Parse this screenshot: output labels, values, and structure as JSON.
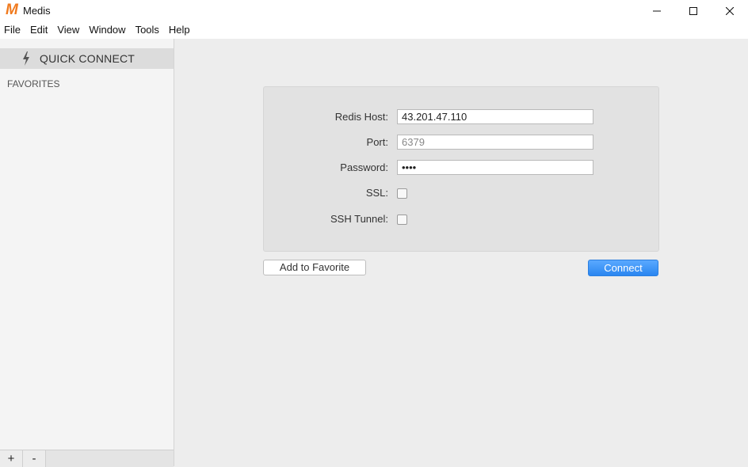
{
  "window": {
    "title": "Medis",
    "logo_letter": "M",
    "controls": [
      "minimize-icon",
      "maximize-icon",
      "close-icon"
    ]
  },
  "menu": [
    "File",
    "Edit",
    "View",
    "Window",
    "Tools",
    "Help"
  ],
  "sidebar": {
    "quick_connect_label": "QUICK CONNECT",
    "quick_connect_icon": "bolt-icon",
    "favorites_title": "FAVORITES",
    "footer": {
      "add_label": "+",
      "remove_label": "-"
    }
  },
  "form": {
    "host_label": "Redis Host:",
    "host_value": "43.201.47.110",
    "port_label": "Port:",
    "port_placeholder": "6379",
    "password_label": "Password:",
    "password_value": "pass",
    "ssl_label": "SSL:",
    "ssl_checked": false,
    "ssh_label": "SSH Tunnel:",
    "ssh_checked": false
  },
  "actions": {
    "favorite_label": "Add to Favorite",
    "connect_label": "Connect"
  },
  "colors": {
    "logo": "#f07a1e",
    "connect_button": "#2a86f0",
    "panel": "#e2e2e2"
  }
}
